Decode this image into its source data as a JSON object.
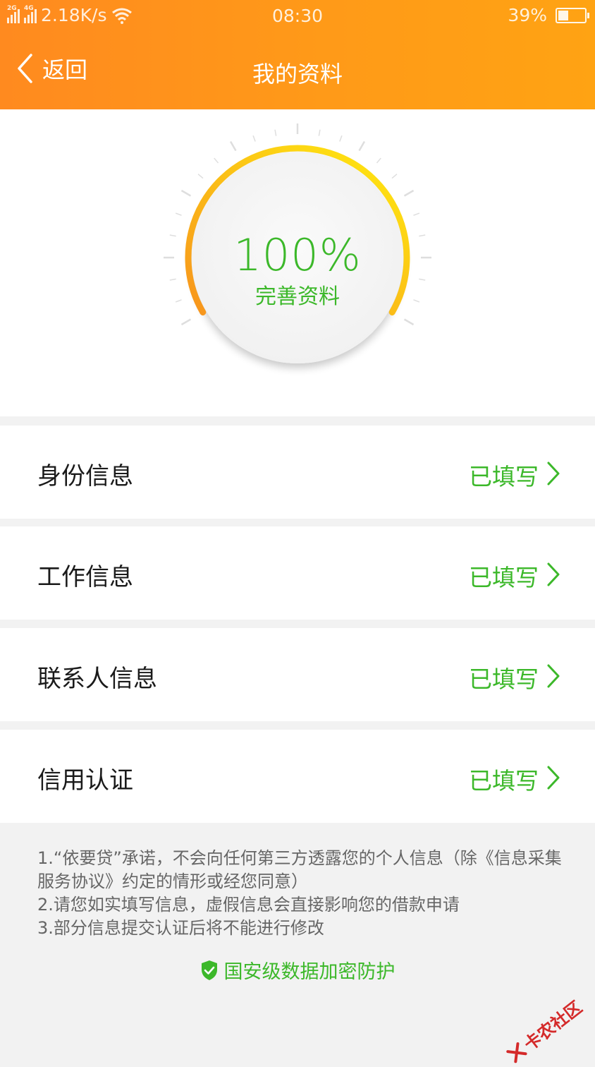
{
  "status_bar": {
    "network_1": "2G",
    "network_2": "4G",
    "speed": "2.18K/s",
    "time": "08:30",
    "battery": "39%",
    "battery_level": 0.39,
    "icons": [
      "signal-icon",
      "wifi-icon",
      "battery-icon"
    ]
  },
  "nav": {
    "back_label": "返回",
    "title": "我的资料"
  },
  "progress": {
    "percent_text": "100%",
    "percent_value": 100,
    "label": "完善资料"
  },
  "sections": [
    {
      "label": "身份信息",
      "status": "已填写"
    },
    {
      "label": "工作信息",
      "status": "已填写"
    },
    {
      "label": "联系人信息",
      "status": "已填写"
    },
    {
      "label": "信用认证",
      "status": "已填写"
    }
  ],
  "notes": [
    "1.“依要贷”承诺，不会向任何第三方透露您的个人信息（除《信息采集服务协议》约定的情形或经您同意）",
    "2.请您如实填写信息，虚假信息会直接影响您的借款申请",
    "3.部分信息提交认证后将不能进行修改"
  ],
  "secure_label": "国安级数据加密防护",
  "watermark": "卡农社区",
  "colors": {
    "header_orange": "#ff9a18",
    "accent_green": "#3cb82a",
    "gauge_start": "#f7941d",
    "gauge_end": "#ffec10"
  }
}
